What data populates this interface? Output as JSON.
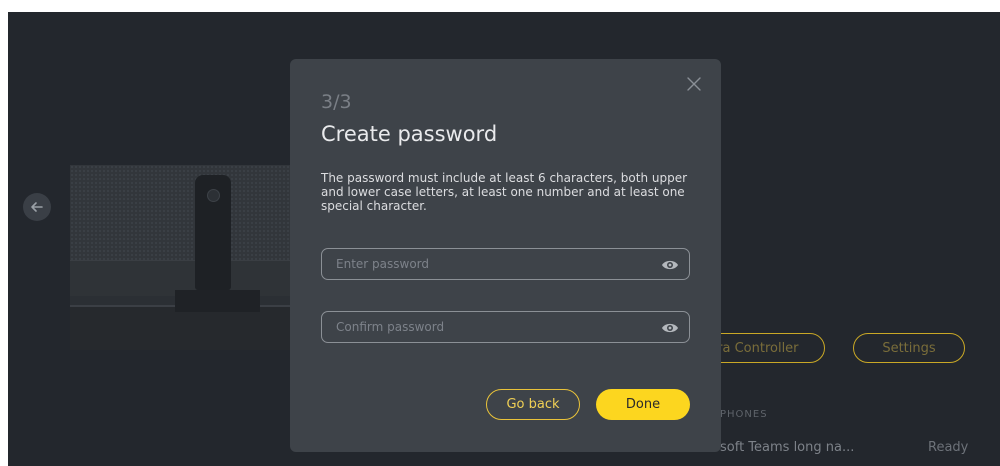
{
  "background": {
    "camera_controller_label": "mera Controller",
    "settings_label": "Settings",
    "section_label": "PHONES",
    "device_name": "soft Teams long na...",
    "device_status": "Ready"
  },
  "dialog": {
    "step": "3/3",
    "title": "Create password",
    "description": "The password must include at least 6 characters, both upper and lower case letters, at least one number and at least one special character.",
    "password_placeholder": "Enter password",
    "confirm_placeholder": "Confirm password",
    "back_label": "Go back",
    "done_label": "Done"
  },
  "icons": {
    "close": "close-icon",
    "eye": "eye-icon",
    "back_arrow": "arrow-left-icon"
  },
  "colors": {
    "accent": "#fcd61f",
    "dialog_bg": "#3e4349",
    "app_bg": "#23272d"
  }
}
